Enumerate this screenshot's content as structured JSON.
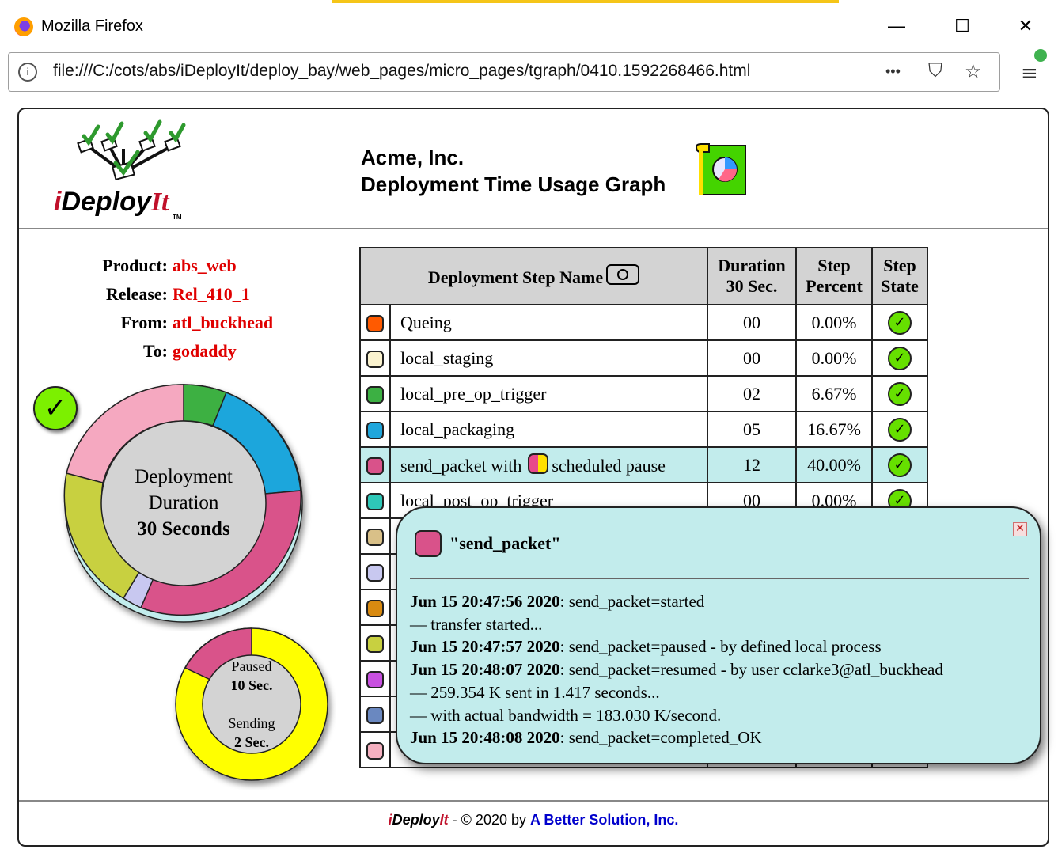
{
  "window": {
    "title": "Mozilla Firefox",
    "minimize": "—",
    "maximize": "☐",
    "close": "✕"
  },
  "urlbar": {
    "url": "file:///C:/cots/abs/iDeployIt/deploy_bay/web_pages/micro_pages/tgraph/0410.1592268466.html",
    "info_icon": "i",
    "more_icon": "•••",
    "pocket_icon": "⛉",
    "star_icon": "☆",
    "menu_icon": "≡"
  },
  "logo": {
    "i": "i",
    "deploy": "Deploy",
    "it": "It",
    "tm": "TM"
  },
  "header": {
    "company": "Acme, Inc.",
    "title": "Deployment Time Usage Graph"
  },
  "info": {
    "product_label": "Product:",
    "product": "abs_web",
    "release_label": "Release:",
    "release": "Rel_410_1",
    "from_label": "From:",
    "from": "atl_buckhead",
    "to_label": "To:",
    "to": "godaddy"
  },
  "status_check": "✓",
  "donut": {
    "line1": "Deployment",
    "line2": "Duration",
    "line3": "30 Seconds"
  },
  "pause_donut": {
    "paused_label": "Paused",
    "paused_value": "10 Sec.",
    "sending_label": "Sending",
    "sending_value": "2 Sec."
  },
  "table": {
    "col_name": "Deployment Step Name",
    "col_duration_1": "Duration",
    "col_duration_2": "30 Sec.",
    "col_percent_1": "Step",
    "col_percent_2": "Percent",
    "col_state_1": "Step",
    "col_state_2": "State",
    "rows": [
      {
        "name": "Queing",
        "duration": "00",
        "percent": "0.00%",
        "color": "#ff5a00"
      },
      {
        "name": "local_staging",
        "duration": "00",
        "percent": "0.00%",
        "color": "#fbf3cf"
      },
      {
        "name": "local_pre_op_trigger",
        "duration": "02",
        "percent": "6.67%",
        "color": "#3cb043"
      },
      {
        "name": "local_packaging",
        "duration": "05",
        "percent": "16.67%",
        "color": "#1fa6dc"
      },
      {
        "name": "send_packet with",
        "name_suffix": "scheduled pause",
        "duration": "12",
        "percent": "40.00%",
        "color": "#d9528a"
      },
      {
        "name": "local_post_op_trigger",
        "duration": "00",
        "percent": "0.00%",
        "color": "#2ec8b8"
      },
      {
        "color": "#d9c088"
      },
      {
        "color": "#c8c8f0"
      },
      {
        "color": "#d98a10"
      },
      {
        "color": "#c8d040"
      },
      {
        "color": "#c850e0"
      },
      {
        "color": "#6a88c0"
      },
      {
        "color": "#f5b0c0"
      }
    ]
  },
  "popup": {
    "title": "\"send_packet\"",
    "close": "✕",
    "log": [
      {
        "ts": "Jun 15 20:47:56 2020",
        "msg": ": send_packet=started"
      },
      {
        "ts": "",
        "msg": "— transfer started..."
      },
      {
        "ts": "Jun 15 20:47:57 2020",
        "msg": ": send_packet=paused - by defined local process"
      },
      {
        "ts": "Jun 15 20:48:07 2020",
        "msg": ": send_packet=resumed - by user cclarke3@atl_buckhead"
      },
      {
        "ts": "",
        "msg": "— 259.354 K sent in 1.417 seconds..."
      },
      {
        "ts": "",
        "msg": "— with actual bandwidth = 183.030 K/second."
      },
      {
        "ts": "Jun 15 20:48:08 2020",
        "msg": ": send_packet=completed_OK"
      }
    ]
  },
  "footer": {
    "i": "i",
    "deploy": "Deploy",
    "it": "It",
    "copyright": " - © 2020 by ",
    "link": "A Better Solution, Inc."
  }
}
